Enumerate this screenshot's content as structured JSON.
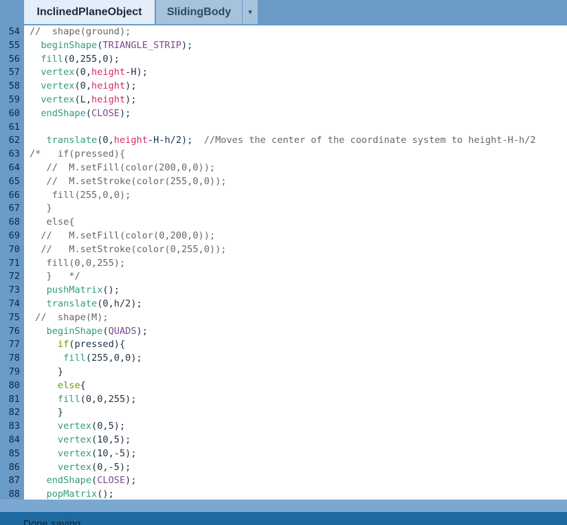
{
  "tabs": [
    {
      "label": "InclinedPlaneObject",
      "active": true
    },
    {
      "label": "SlidingBody",
      "active": false
    }
  ],
  "tab_menu_icon": "▾",
  "status": {
    "message": "Done saving."
  },
  "colors": {
    "chrome": "#6a9bc7",
    "active_tab": "#e3eef8",
    "inactive_tab": "#a7c2db",
    "status_bar": "#1e6aa0",
    "keyword": "#33997e",
    "variable": "#d12a6a",
    "constant": "#7d4793",
    "conditional": "#669900",
    "comment": "#666666"
  },
  "code_lines": [
    {
      "n": "54",
      "tokens": [
        [
          "cmt",
          "//  shape(ground);"
        ]
      ]
    },
    {
      "n": "55",
      "tokens": [
        [
          "txt",
          "  "
        ],
        [
          "kw",
          "beginShape"
        ],
        [
          "txt",
          "("
        ],
        [
          "cst",
          "TRIANGLE_STRIP"
        ],
        [
          "txt",
          ");"
        ]
      ]
    },
    {
      "n": "56",
      "tokens": [
        [
          "txt",
          "  "
        ],
        [
          "kw",
          "fill"
        ],
        [
          "txt",
          "(0,255,0);"
        ]
      ]
    },
    {
      "n": "57",
      "tokens": [
        [
          "txt",
          "  "
        ],
        [
          "kw",
          "vertex"
        ],
        [
          "txt",
          "(0,"
        ],
        [
          "var",
          "height"
        ],
        [
          "txt",
          "-H);"
        ]
      ]
    },
    {
      "n": "58",
      "tokens": [
        [
          "txt",
          "  "
        ],
        [
          "kw",
          "vertex"
        ],
        [
          "txt",
          "(0,"
        ],
        [
          "var",
          "height"
        ],
        [
          "txt",
          ");"
        ]
      ]
    },
    {
      "n": "59",
      "tokens": [
        [
          "txt",
          "  "
        ],
        [
          "kw",
          "vertex"
        ],
        [
          "txt",
          "(L,"
        ],
        [
          "var",
          "height"
        ],
        [
          "txt",
          ");"
        ]
      ]
    },
    {
      "n": "60",
      "tokens": [
        [
          "txt",
          "  "
        ],
        [
          "kw",
          "endShape"
        ],
        [
          "txt",
          "("
        ],
        [
          "cst",
          "CLOSE"
        ],
        [
          "txt",
          ");"
        ]
      ]
    },
    {
      "n": "61",
      "tokens": []
    },
    {
      "n": "62",
      "tokens": [
        [
          "txt",
          "   "
        ],
        [
          "kw",
          "translate"
        ],
        [
          "txt",
          "(0,"
        ],
        [
          "var",
          "height"
        ],
        [
          "txt",
          "-H-h/2);  "
        ],
        [
          "cmt",
          "//Moves the center of the coordinate system to height-H-h/2"
        ]
      ]
    },
    {
      "n": "63",
      "tokens": [
        [
          "cmt",
          "/*   if(pressed){"
        ]
      ]
    },
    {
      "n": "64",
      "tokens": [
        [
          "cmt",
          "   //  M.setFill(color(200,0,0));"
        ]
      ]
    },
    {
      "n": "65",
      "tokens": [
        [
          "cmt",
          "   //  M.setStroke(color(255,0,0));"
        ]
      ]
    },
    {
      "n": "66",
      "tokens": [
        [
          "cmt",
          "    fill(255,0,0);"
        ]
      ]
    },
    {
      "n": "67",
      "tokens": [
        [
          "cmt",
          "   }"
        ]
      ]
    },
    {
      "n": "68",
      "tokens": [
        [
          "cmt",
          "   else{"
        ]
      ]
    },
    {
      "n": "69",
      "tokens": [
        [
          "cmt",
          "  //   M.setFill(color(0,200,0));"
        ]
      ]
    },
    {
      "n": "70",
      "tokens": [
        [
          "cmt",
          "  //   M.setStroke(color(0,255,0));"
        ]
      ]
    },
    {
      "n": "71",
      "tokens": [
        [
          "cmt",
          "   fill(0,0,255);"
        ]
      ]
    },
    {
      "n": "72",
      "tokens": [
        [
          "cmt",
          "   }   */"
        ]
      ]
    },
    {
      "n": "73",
      "tokens": [
        [
          "txt",
          "   "
        ],
        [
          "kw",
          "pushMatrix"
        ],
        [
          "txt",
          "();"
        ]
      ]
    },
    {
      "n": "74",
      "tokens": [
        [
          "txt",
          "   "
        ],
        [
          "kw",
          "translate"
        ],
        [
          "txt",
          "(0,h/2);"
        ]
      ]
    },
    {
      "n": "75",
      "tokens": [
        [
          "cmt",
          " //  shape(M);"
        ]
      ]
    },
    {
      "n": "76",
      "tokens": [
        [
          "txt",
          "   "
        ],
        [
          "kw",
          "beginShape"
        ],
        [
          "txt",
          "("
        ],
        [
          "cst",
          "QUADS"
        ],
        [
          "txt",
          ");"
        ]
      ]
    },
    {
      "n": "77",
      "tokens": [
        [
          "txt",
          "     "
        ],
        [
          "cond",
          "if"
        ],
        [
          "txt",
          "(pressed){"
        ]
      ]
    },
    {
      "n": "78",
      "tokens": [
        [
          "txt",
          "      "
        ],
        [
          "kw",
          "fill"
        ],
        [
          "txt",
          "(255,0,0);"
        ]
      ]
    },
    {
      "n": "79",
      "tokens": [
        [
          "txt",
          "     }"
        ]
      ]
    },
    {
      "n": "80",
      "tokens": [
        [
          "txt",
          "     "
        ],
        [
          "cond",
          "else"
        ],
        [
          "txt",
          "{"
        ]
      ]
    },
    {
      "n": "81",
      "tokens": [
        [
          "txt",
          "     "
        ],
        [
          "kw",
          "fill"
        ],
        [
          "txt",
          "(0,0,255);"
        ]
      ]
    },
    {
      "n": "82",
      "tokens": [
        [
          "txt",
          "     }"
        ]
      ]
    },
    {
      "n": "83",
      "tokens": [
        [
          "txt",
          "     "
        ],
        [
          "kw",
          "vertex"
        ],
        [
          "txt",
          "(0,5);"
        ]
      ]
    },
    {
      "n": "84",
      "tokens": [
        [
          "txt",
          "     "
        ],
        [
          "kw",
          "vertex"
        ],
        [
          "txt",
          "(10,5);"
        ]
      ]
    },
    {
      "n": "85",
      "tokens": [
        [
          "txt",
          "     "
        ],
        [
          "kw",
          "vertex"
        ],
        [
          "txt",
          "(10,-5);"
        ]
      ]
    },
    {
      "n": "86",
      "tokens": [
        [
          "txt",
          "     "
        ],
        [
          "kw",
          "vertex"
        ],
        [
          "txt",
          "(0,-5);"
        ]
      ]
    },
    {
      "n": "87",
      "tokens": [
        [
          "txt",
          "   "
        ],
        [
          "kw",
          "endShape"
        ],
        [
          "txt",
          "("
        ],
        [
          "cst",
          "CLOSE"
        ],
        [
          "txt",
          ");"
        ]
      ]
    },
    {
      "n": "88",
      "tokens": [
        [
          "txt",
          "   "
        ],
        [
          "kw",
          "popMatrix"
        ],
        [
          "txt",
          "();"
        ]
      ]
    }
  ]
}
